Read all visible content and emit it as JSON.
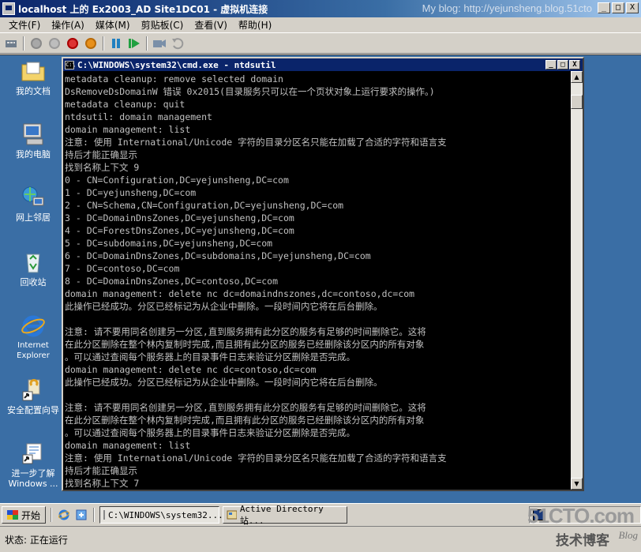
{
  "window": {
    "title": "localhost 上的 Ex2003_AD Site1DC01 - 虚拟机连接",
    "blog_watermark": "My blog: http://yejunsheng.blog.51cto",
    "minimize": "_",
    "maximize": "□",
    "close": "X"
  },
  "menu": [
    "文件(F)",
    "操作(A)",
    "媒体(M)",
    "剪贴板(C)",
    "查看(V)",
    "帮助(H)"
  ],
  "toolbar": {
    "icons": [
      "ctrl-alt-del-icon",
      "start-icon",
      "turn-off-icon",
      "shutdown-icon",
      "save-icon",
      "pause-icon",
      "reset-icon",
      "snapshot-icon",
      "revert-icon"
    ]
  },
  "desktop": {
    "icons": [
      {
        "name": "my-documents",
        "label": "我的文档"
      },
      {
        "name": "my-computer",
        "label": "我的电脑"
      },
      {
        "name": "network-places",
        "label": "网上邻居"
      },
      {
        "name": "recycle-bin",
        "label": "回收站"
      },
      {
        "name": "internet-explorer",
        "label": "Internet\nExplorer"
      },
      {
        "name": "security-wizard",
        "label": "安全配置向导"
      },
      {
        "name": "get-started",
        "label": "进一步了解\nWindows ..."
      }
    ]
  },
  "cmd": {
    "title": "C:\\WINDOWS\\system32\\cmd.exe - ntdsutil",
    "lines": [
      "metadata cleanup: remove selected domain",
      "DsRemoveDsDomainW 错误 0x2015(目录服务只可以在一个页状对象上运行要求的操作。)",
      "metadata cleanup: quit",
      "ntdsutil: domain management",
      "domain management: list",
      "注意: 使用 International/Unicode 字符的目录分区名只能在加载了合适的字符和语言支",
      "持后才能正确显示",
      "找到名称上下文 9",
      "0 - CN=Configuration,DC=yejunsheng,DC=com",
      "1 - DC=yejunsheng,DC=com",
      "2 - CN=Schema,CN=Configuration,DC=yejunsheng,DC=com",
      "3 - DC=DomainDnsZones,DC=yejunsheng,DC=com",
      "4 - DC=ForestDnsZones,DC=yejunsheng,DC=com",
      "5 - DC=subdomains,DC=yejunsheng,DC=com",
      "6 - DC=DomainDnsZones,DC=subdomains,DC=yejunsheng,DC=com",
      "7 - DC=contoso,DC=com",
      "8 - DC=DomainDnsZones,DC=contoso,DC=com",
      "domain management: delete nc dc=domaindnszones,dc=contoso,dc=com",
      "此操作已经成功。分区已经标记为从企业中删除。一段时间内它将在后台删除。",
      "",
      "注意: 请不要用同名创建另一分区,直到服务拥有此分区的服务有足够的时间删除它。这将",
      "在此分区删除在整个林内复制时完成,而且拥有此分区的服务已经删除该分区内的所有对象",
      "。可以通过查阅每个服务器上的目录事件日志来验证分区删除是否完成。",
      "domain management: delete nc dc=contoso,dc=com",
      "此操作已经成功。分区已经标记为从企业中删除。一段时间内它将在后台删除。",
      "",
      "注意: 请不要用同名创建另一分区,直到服务拥有此分区的服务有足够的时间删除它。这将",
      "在此分区删除在整个林内复制时完成,而且拥有此分区的服务已经删除该分区内的所有对象",
      "。可以通过查阅每个服务器上的目录事件日志来验证分区删除是否完成。",
      "domain management: list",
      "注意: 使用 International/Unicode 字符的目录分区名只能在加载了合适的字符和语言支",
      "持后才能正确显示",
      "找到名称上下文 7"
    ]
  },
  "taskbar": {
    "start": "开始",
    "buttons": [
      {
        "label": "C:\\WINDOWS\\system32...",
        "active": true
      },
      {
        "label": "Active Directory 站...",
        "active": false
      }
    ],
    "watermark": "51CTO.com"
  },
  "statusbar": {
    "label": "状态: 正在运行",
    "watermark1": "技术博客",
    "watermark2": "Blog"
  }
}
